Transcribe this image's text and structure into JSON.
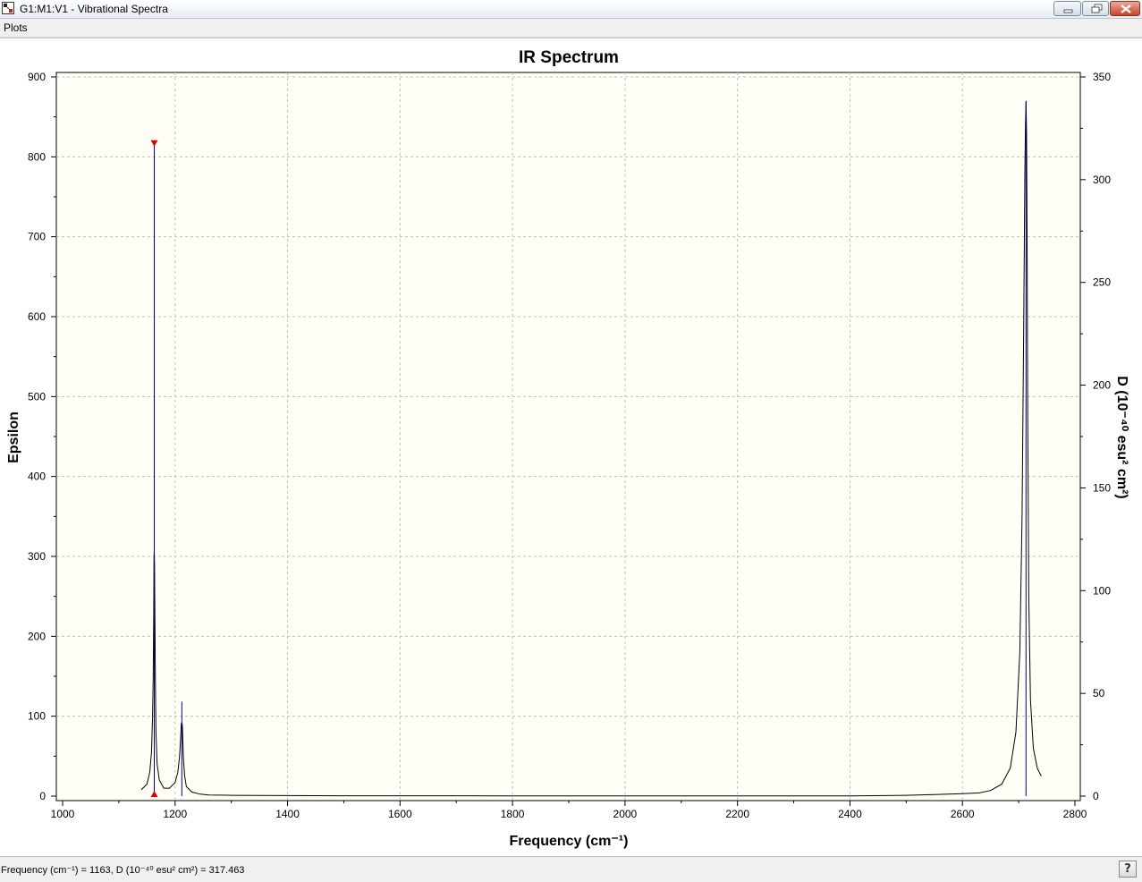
{
  "window": {
    "title": "G1:M1:V1 - Vibrational Spectra",
    "icon": "app-icon",
    "controls": {
      "minimize_icon": "minimize-icon",
      "maximize_icon": "restore-icon",
      "close_icon": "close-icon"
    }
  },
  "menu": {
    "items": [
      {
        "label": "Plots"
      }
    ]
  },
  "status": {
    "readout": "Frequency (cm⁻¹) = 1163, D (10⁻⁴⁰ esu² cm²) = 317.463",
    "help_label": "?"
  },
  "colors": {
    "plot_background": "#fffff7",
    "spectrum_line": "#000000",
    "stick_line": "#000080",
    "marker": "#dd0000",
    "grid": "#c0c0c0"
  },
  "chart_data": {
    "type": "line",
    "title": "IR Spectrum",
    "xlabel": "Frequency (cm⁻¹)",
    "ylabel": "Epsilon",
    "y2label": "D (10⁻⁴⁰ esu² cm²)",
    "xlim": [
      1000,
      2800
    ],
    "ylim": [
      -10,
      900
    ],
    "y2lim": [
      -3.889,
      350
    ],
    "xticks": [
      1000,
      1200,
      1400,
      1600,
      1800,
      2000,
      2200,
      2400,
      2600,
      2800
    ],
    "yticks": [
      0,
      100,
      200,
      300,
      400,
      500,
      600,
      700,
      800,
      900
    ],
    "y2ticks": [
      0,
      50,
      100,
      150,
      200,
      250,
      300,
      350
    ],
    "grid": true,
    "spectrum": {
      "name": "Epsilon",
      "x": [
        1140,
        1150,
        1155,
        1158,
        1160,
        1161,
        1162,
        1162.5,
        1163,
        1163.5,
        1164,
        1165,
        1166,
        1168,
        1172,
        1180,
        1190,
        1200,
        1205,
        1208,
        1210,
        1211,
        1212,
        1212.5,
        1213,
        1214,
        1215,
        1217,
        1220,
        1230,
        1245,
        1260,
        1300,
        1500,
        1800,
        2100,
        2400,
        2500,
        2550,
        2600,
        2630,
        2650,
        2670,
        2685,
        2695,
        2702,
        2706,
        2709,
        2711,
        2712,
        2713,
        2714,
        2715,
        2716,
        2718,
        2721,
        2726,
        2733,
        2740
      ],
      "values": [
        8,
        15,
        30,
        55,
        100,
        150,
        230,
        300,
        307,
        290,
        240,
        140,
        80,
        40,
        20,
        10,
        10,
        17,
        30,
        50,
        75,
        90,
        92,
        91,
        86,
        65,
        45,
        25,
        12,
        5,
        2.5,
        1.5,
        1,
        0.5,
        0.3,
        0.3,
        0.3,
        1,
        2,
        3,
        4,
        7,
        15,
        35,
        80,
        180,
        350,
        600,
        780,
        840,
        870,
        830,
        700,
        480,
        250,
        120,
        60,
        35,
        25
      ]
    },
    "sticks": [
      {
        "x": 1163,
        "D": 317.463
      },
      {
        "x": 1212,
        "D": 46
      },
      {
        "x": 2713,
        "D": 338
      }
    ],
    "selected": {
      "x": 1163,
      "D": 317.463
    }
  }
}
